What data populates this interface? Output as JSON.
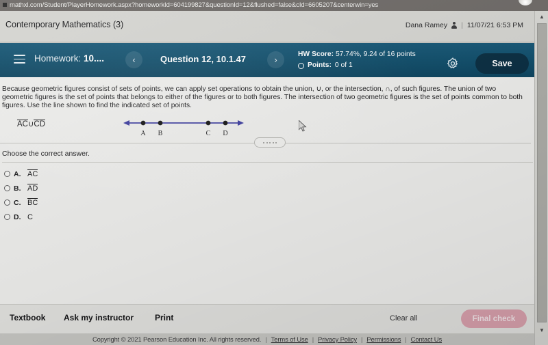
{
  "browser": {
    "url": "mathxl.com/Student/PlayerHomework.aspx?homeworkId=604199827&questionId=12&flushed=false&cId=6605207&centerwin=yes"
  },
  "page_header": {
    "course_title": "Contemporary Mathematics (3)",
    "user_name": "Dana Ramey",
    "separator": "|",
    "timestamp": "11/07/21 6:53 PM"
  },
  "toolbar": {
    "homework_label_prefix": "Homework: ",
    "homework_label_value": "10....",
    "prev_icon": "‹",
    "next_icon": "›",
    "question_label": "Question 12, 10.1.47",
    "hw_score_label": "HW Score: ",
    "hw_score_value": "57.74%, 9.24 of 16 points",
    "points_label": "Points: ",
    "points_value": "0 of 1",
    "save_label": "Save",
    "accent_color": "#12506d"
  },
  "question": {
    "body": "Because geometric figures consist of sets of points, we can apply set operations to obtain the union, ∪, or the intersection, ∩, of such figures. The union of two geometric figures is the set of points that belongs to either of the figures or to both figures. The intersection of two geometric figures is the set of points common to both figures. Use the line shown to find the indicated set of points.",
    "expression_first": "AC",
    "expression_operator": "∪",
    "expression_second": "CD",
    "prompt": "Choose the correct answer.",
    "figure": {
      "type": "number-line",
      "line_color": "#3b3b9e",
      "points": [
        "A",
        "B",
        "C",
        "D"
      ],
      "point_positions": [
        0.17,
        0.31,
        0.7,
        0.84
      ],
      "arrows": "both"
    },
    "choices": [
      {
        "letter": "A.",
        "value": "AC",
        "overline": true,
        "selected": false
      },
      {
        "letter": "B.",
        "value": "AD",
        "overline": true,
        "selected": false
      },
      {
        "letter": "C.",
        "value": "BC",
        "overline": true,
        "selected": false
      },
      {
        "letter": "D.",
        "value": "C",
        "overline": false,
        "selected": false
      }
    ]
  },
  "action_bar": {
    "textbook_label": "Textbook",
    "ask_instructor_label": "Ask my instructor",
    "print_label": "Print",
    "clear_all_label": "Clear all",
    "final_check_label": "Final check",
    "final_check_color": "#d9a1ad"
  },
  "footer": {
    "copyright": "Copyright © 2021 Pearson Education Inc. All rights reserved.",
    "sep": "|",
    "links": [
      "Terms of Use",
      "Privacy Policy",
      "Permissions",
      "Contact Us"
    ]
  },
  "scrollbar": {
    "up_icon": "▲",
    "down_icon": "▼"
  }
}
